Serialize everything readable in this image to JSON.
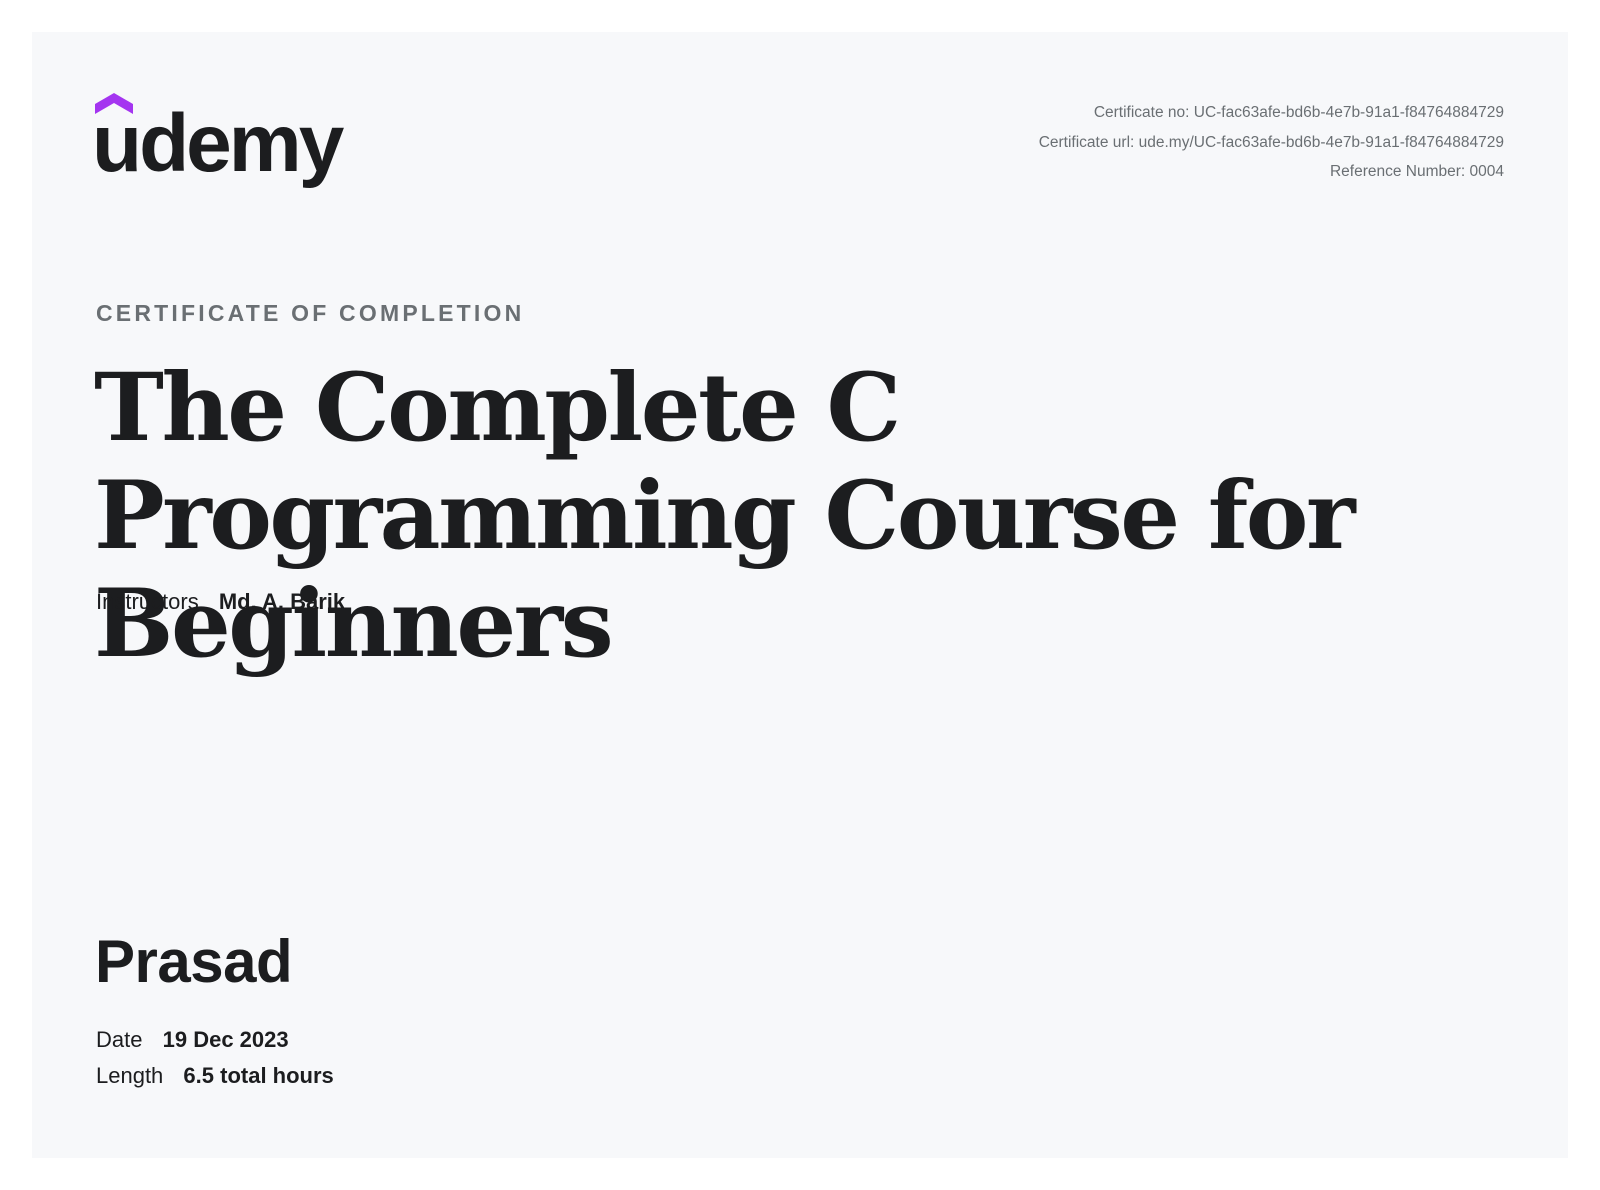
{
  "brand": {
    "logo_text": "udemy",
    "accent_color": "#a435f0"
  },
  "meta": {
    "certificate_no": "Certificate no: UC-fac63afe-bd6b-4e7b-91a1-f84764884729",
    "certificate_url": "Certificate url: ude.my/UC-fac63afe-bd6b-4e7b-91a1-f84764884729",
    "reference_number": "Reference Number: 0004"
  },
  "certificate": {
    "eyebrow": "CERTIFICATE OF COMPLETION",
    "course_title": "The Complete C Programming Course for Beginners",
    "instructors_label": "Instructors",
    "instructors_value": "Md. A. Barik",
    "recipient_name": "Prasad",
    "date_label": "Date",
    "date_value": "19 Dec 2023",
    "length_label": "Length",
    "length_value": "6.5 total hours"
  }
}
